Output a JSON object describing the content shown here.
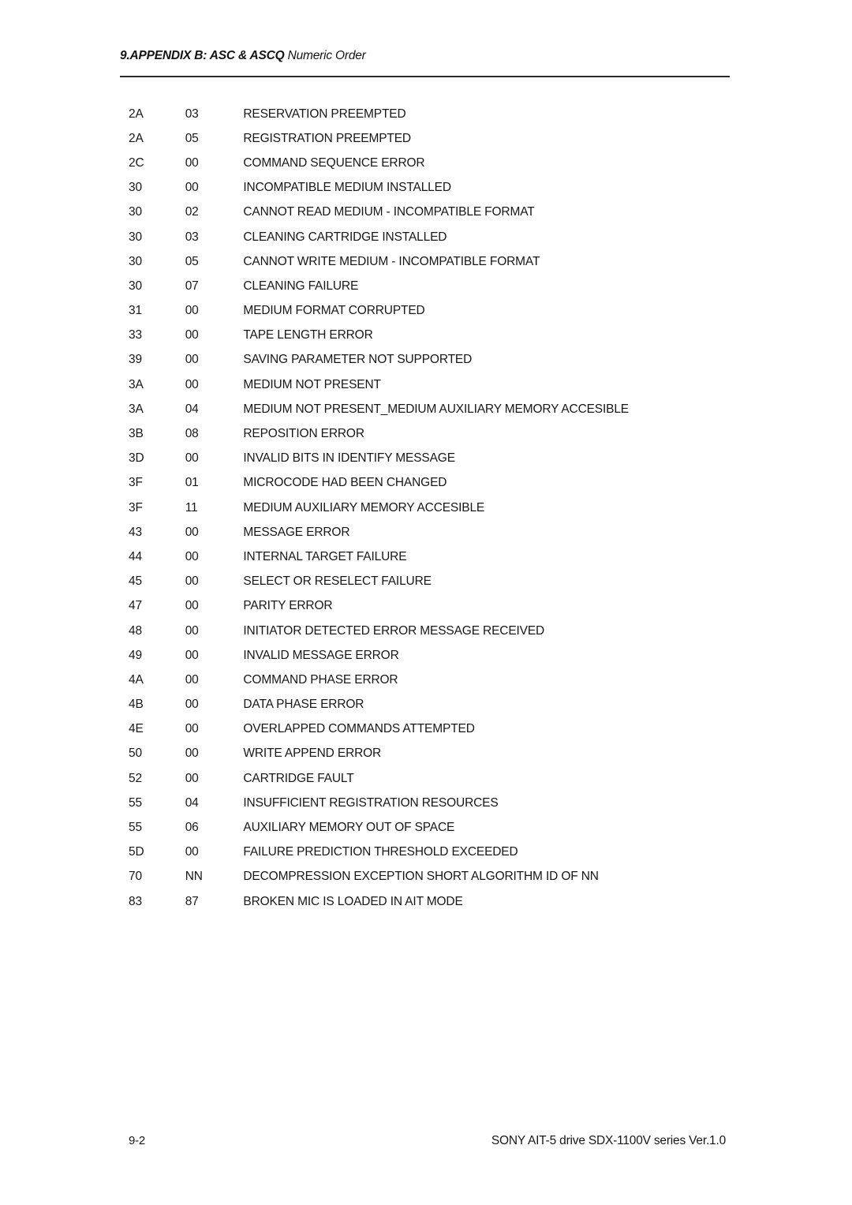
{
  "header": {
    "title_lead": "9.APPENDIX B: ASC & ASCQ ",
    "title_tail": "Numeric Order"
  },
  "table": {
    "rows": [
      {
        "asc": "2A",
        "ascq": "03",
        "description": "RESERVATION PREEMPTED"
      },
      {
        "asc": "2A",
        "ascq": "05",
        "description": "REGISTRATION PREEMPTED"
      },
      {
        "asc": "2C",
        "ascq": "00",
        "description": "COMMAND SEQUENCE ERROR"
      },
      {
        "asc": "30",
        "ascq": "00",
        "description": "INCOMPATIBLE MEDIUM INSTALLED"
      },
      {
        "asc": "30",
        "ascq": "02",
        "description": "CANNOT READ MEDIUM - INCOMPATIBLE FORMAT"
      },
      {
        "asc": "30",
        "ascq": "03",
        "description": "CLEANING CARTRIDGE INSTALLED"
      },
      {
        "asc": "30",
        "ascq": "05",
        "description": "CANNOT WRITE MEDIUM - INCOMPATIBLE FORMAT"
      },
      {
        "asc": "30",
        "ascq": "07",
        "description": "CLEANING FAILURE"
      },
      {
        "asc": "31",
        "ascq": "00",
        "description": "MEDIUM FORMAT CORRUPTED"
      },
      {
        "asc": "33",
        "ascq": "00",
        "description": "TAPE LENGTH ERROR"
      },
      {
        "asc": "39",
        "ascq": "00",
        "description": "SAVING PARAMETER NOT SUPPORTED"
      },
      {
        "asc": "3A",
        "ascq": "00",
        "description": "MEDIUM NOT PRESENT"
      },
      {
        "asc": "3A",
        "ascq": "04",
        "description": "MEDIUM NOT PRESENT_MEDIUM AUXILIARY MEMORY ACCESIBLE"
      },
      {
        "asc": "3B",
        "ascq": "08",
        "description": "REPOSITION ERROR"
      },
      {
        "asc": "3D",
        "ascq": "00",
        "description": "INVALID BITS IN IDENTIFY MESSAGE"
      },
      {
        "asc": "3F",
        "ascq": "01",
        "description": "MICROCODE HAD BEEN CHANGED"
      },
      {
        "asc": "3F",
        "ascq": "11",
        "description": "MEDIUM AUXILIARY MEMORY ACCESIBLE"
      },
      {
        "asc": "43",
        "ascq": "00",
        "description": "MESSAGE ERROR"
      },
      {
        "asc": "44",
        "ascq": "00",
        "description": "INTERNAL TARGET FAILURE"
      },
      {
        "asc": "45",
        "ascq": "00",
        "description": "SELECT OR RESELECT FAILURE"
      },
      {
        "asc": "47",
        "ascq": "00",
        "description": "PARITY ERROR"
      },
      {
        "asc": "48",
        "ascq": "00",
        "description": "INITIATOR DETECTED ERROR MESSAGE RECEIVED"
      },
      {
        "asc": "49",
        "ascq": "00",
        "description": "INVALID MESSAGE ERROR"
      },
      {
        "asc": "4A",
        "ascq": "00",
        "description": "COMMAND PHASE ERROR"
      },
      {
        "asc": "4B",
        "ascq": "00",
        "description": "DATA PHASE ERROR"
      },
      {
        "asc": "4E",
        "ascq": "00",
        "description": "OVERLAPPED COMMANDS ATTEMPTED"
      },
      {
        "asc": "50",
        "ascq": "00",
        "description": "WRITE APPEND ERROR"
      },
      {
        "asc": "52",
        "ascq": "00",
        "description": "CARTRIDGE FAULT"
      },
      {
        "asc": "55",
        "ascq": "04",
        "description": "INSUFFICIENT REGISTRATION RESOURCES"
      },
      {
        "asc": "55",
        "ascq": "06",
        "description": "AUXILIARY MEMORY OUT OF SPACE"
      },
      {
        "asc": "5D",
        "ascq": "00",
        "description": "FAILURE PREDICTION THRESHOLD EXCEEDED"
      },
      {
        "asc": "70",
        "ascq": "NN",
        "description": "DECOMPRESSION EXCEPTION SHORT ALGORITHM ID OF NN"
      },
      {
        "asc": "83",
        "ascq": "87",
        "description": "BROKEN MIC IS LOADED IN AIT MODE"
      }
    ]
  },
  "footer": {
    "page_number": "9-2",
    "product": "SONY AIT-5 drive SDX-1100V series Ver.1.0"
  }
}
